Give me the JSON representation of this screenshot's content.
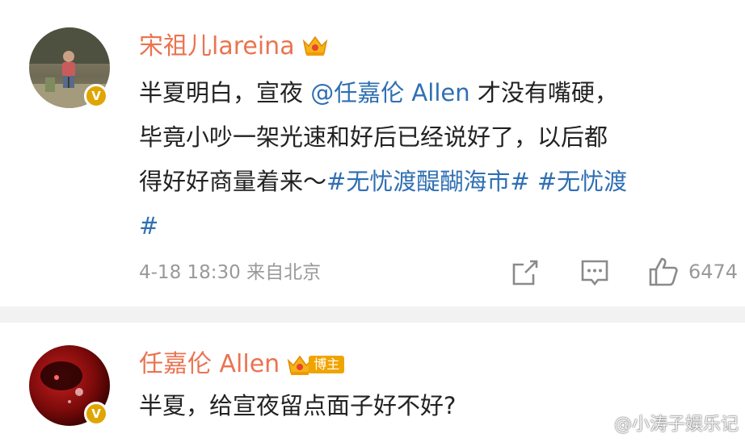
{
  "posts": [
    {
      "username": "宋祖儿lareina",
      "badge_icon": "crown-icon",
      "content": {
        "line1_a": "半夏明白，宣夜 ",
        "line1_mention": "@任嘉伦 Allen",
        "line1_b": " 才没有嘴硬，",
        "line2": "毕竟小吵一架光速和好后已经说好了，以后都",
        "line3_a": "得好好商量着来～",
        "line3_tag1": "#无忧渡醍醐海市#",
        "line3_tag2": " #无忧渡",
        "line4_tag2_end": "#"
      },
      "meta": "4-18 18:30  来自北京",
      "like_count": "6474"
    },
    {
      "username": "任嘉伦 Allen",
      "badge_icon": "crown-icon",
      "tag": "博主",
      "content": {
        "line1": "半夏，给宣夜留点面子好不好?"
      }
    }
  ],
  "watermark": "@小涛子娱乐记",
  "colors": {
    "username": "#eb7350",
    "link": "#2f6fb3",
    "meta": "#999999",
    "verified": "#e0a500"
  }
}
